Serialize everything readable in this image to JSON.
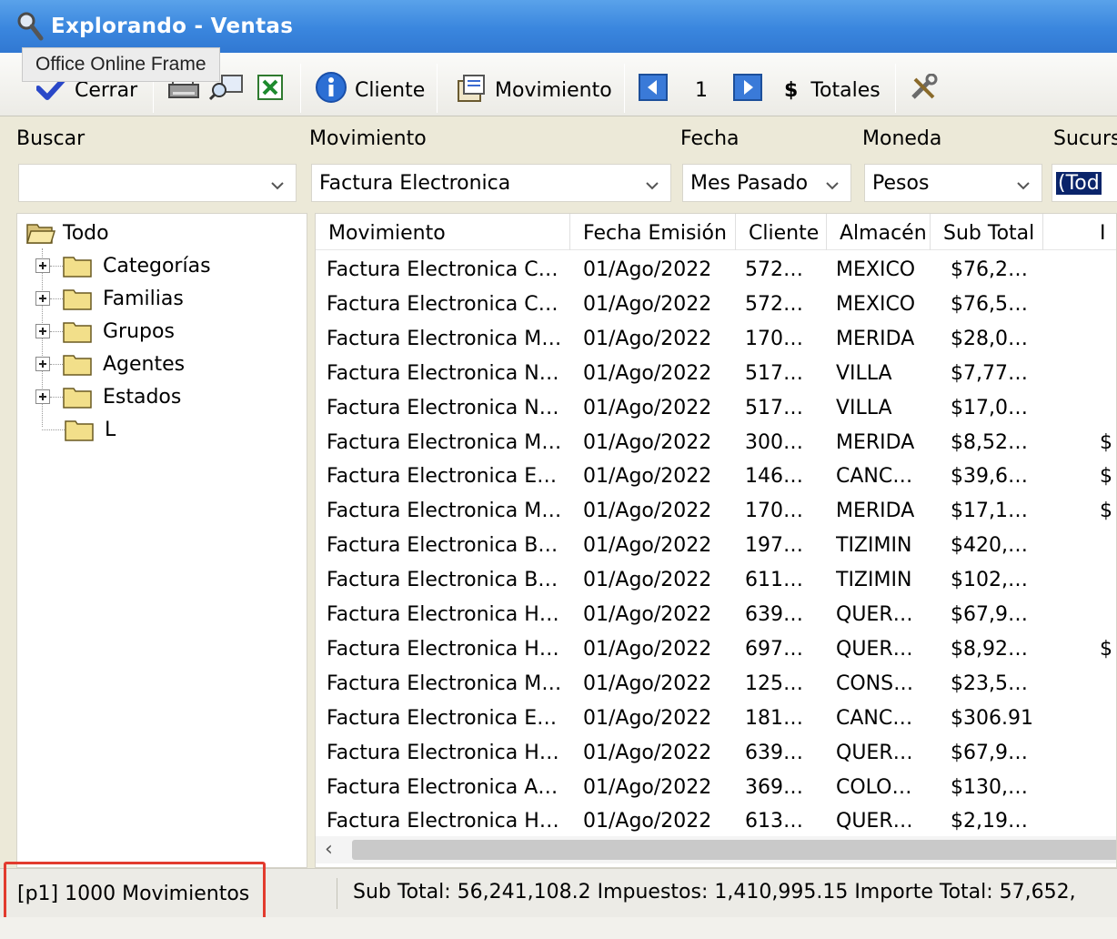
{
  "window": {
    "title": "Explorando - Ventas"
  },
  "tooltip": {
    "text": "Office Online Frame"
  },
  "toolbar": {
    "cerrar": "Cerrar",
    "cliente": "Cliente",
    "movimiento": "Movimiento",
    "page": "1",
    "totales_symbol": "$",
    "totales": "Totales"
  },
  "filters": {
    "buscar": {
      "label": "Buscar",
      "value": ""
    },
    "movimiento": {
      "label": "Movimiento",
      "value": "Factura Electronica"
    },
    "fecha": {
      "label": "Fecha",
      "value": "Mes Pasado"
    },
    "moneda": {
      "label": "Moneda",
      "value": "Pesos"
    },
    "sucursal": {
      "label": "Sucurs",
      "value": "(Tod"
    }
  },
  "tree": {
    "root": "Todo",
    "items": [
      "Categorías",
      "Familias",
      "Grupos",
      "Agentes",
      "Estados",
      "L"
    ]
  },
  "grid": {
    "columns": [
      "Movimiento",
      "Fecha Emisión",
      "Cliente",
      "Almacén",
      "Sub Total",
      "I"
    ],
    "rows": [
      [
        "Factura Electronica C…",
        "01/Ago/2022",
        "572…",
        "MEXICO",
        "$76,2…",
        ""
      ],
      [
        "Factura Electronica C…",
        "01/Ago/2022",
        "572…",
        "MEXICO",
        "$76,5…",
        ""
      ],
      [
        "Factura Electronica M…",
        "01/Ago/2022",
        "170…",
        "MERIDA",
        "$28,0…",
        ""
      ],
      [
        "Factura Electronica N…",
        "01/Ago/2022",
        "517…",
        "VILLA",
        "$7,77…",
        ""
      ],
      [
        "Factura Electronica N…",
        "01/Ago/2022",
        "517…",
        "VILLA",
        "$17,0…",
        ""
      ],
      [
        "Factura Electronica M…",
        "01/Ago/2022",
        "300…",
        "MERIDA",
        "$8,52…",
        "$"
      ],
      [
        "Factura Electronica E…",
        "01/Ago/2022",
        "146…",
        "CANC…",
        "$39,6…",
        "$"
      ],
      [
        "Factura Electronica M…",
        "01/Ago/2022",
        "170…",
        "MERIDA",
        "$17,1…",
        "$"
      ],
      [
        "Factura Electronica B…",
        "01/Ago/2022",
        "197…",
        "TIZIMIN",
        "$420,…",
        ""
      ],
      [
        "Factura Electronica B…",
        "01/Ago/2022",
        "611…",
        "TIZIMIN",
        "$102,…",
        ""
      ],
      [
        "Factura Electronica H…",
        "01/Ago/2022",
        "639…",
        "QUER…",
        "$67,9…",
        ""
      ],
      [
        "Factura Electronica H…",
        "01/Ago/2022",
        "697…",
        "QUER…",
        "$8,92…",
        "$"
      ],
      [
        "Factura Electronica M…",
        "01/Ago/2022",
        "125…",
        "CONS…",
        "$23,5…",
        ""
      ],
      [
        "Factura Electronica E…",
        "01/Ago/2022",
        "181…",
        "CANC…",
        "$306.91",
        ""
      ],
      [
        "Factura Electronica H…",
        "01/Ago/2022",
        "639…",
        "QUER…",
        "$67,9…",
        ""
      ],
      [
        "Factura Electronica A…",
        "01/Ago/2022",
        "369…",
        "COLO…",
        "$130,…",
        ""
      ],
      [
        "Factura Electronica H…",
        "01/Ago/2022",
        "613…",
        "QUER…",
        "$2,19…",
        ""
      ]
    ]
  },
  "status": {
    "count": "[p1] 1000 Movimientos",
    "totals": "Sub Total: 56,241,108.2   Impuestos: 1,410,995.15   Importe Total: 57,652,"
  },
  "colors": {
    "titlebar": "#3a86de",
    "highlight": "#e23b2e"
  },
  "icons": [
    "search-icon",
    "checkmark-icon",
    "printer-icon",
    "preview-icon",
    "excel-icon",
    "info-icon",
    "document-icon",
    "arrow-left-icon",
    "arrow-right-icon",
    "tools-icon",
    "folder-icon",
    "plus-box-icon",
    "chevron-down-icon"
  ]
}
